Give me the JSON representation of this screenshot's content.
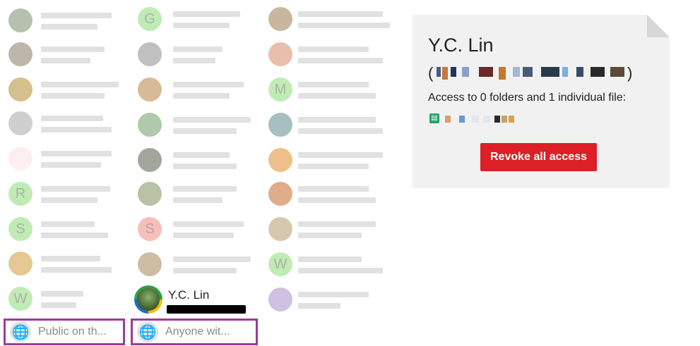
{
  "people": {
    "col1": [
      {
        "avatar": "photo",
        "color": "#7a8c6a"
      },
      {
        "avatar": "photo",
        "color": "#8a7a66"
      },
      {
        "avatar": "photo",
        "color": "#b28a2f"
      },
      {
        "avatar": "photo",
        "color": "#a7a7a7"
      },
      {
        "avatar": "logo",
        "color": "#e24a4a"
      },
      {
        "avatar": "letter",
        "letter": "R",
        "color": "#8fdc7a"
      },
      {
        "avatar": "letter",
        "letter": "S",
        "color": "#8fdc7a"
      },
      {
        "avatar": "photo",
        "color": "#d49a3a"
      },
      {
        "avatar": "letter",
        "letter": "W",
        "color": "#8fdc7a"
      }
    ],
    "col2": [
      {
        "avatar": "letter",
        "letter": "G",
        "color": "#8fdc7a"
      },
      {
        "avatar": "photo",
        "color": "#8d8d8d"
      },
      {
        "avatar": "photo",
        "color": "#b7823f"
      },
      {
        "avatar": "photo",
        "color": "#6d9d64"
      },
      {
        "avatar": "photo",
        "color": "#555c49"
      },
      {
        "avatar": "photo",
        "color": "#7f8f5a"
      },
      {
        "avatar": "letter",
        "letter": "S",
        "color": "#f28b82"
      },
      {
        "avatar": "photo",
        "color": "#a48857"
      }
    ],
    "col3": [
      {
        "avatar": "photo",
        "color": "#9b7c4e"
      },
      {
        "avatar": "photo",
        "color": "#d9896a"
      },
      {
        "avatar": "letter",
        "letter": "M",
        "color": "#8fdc7a"
      },
      {
        "avatar": "photo",
        "color": "#5d8a8e"
      },
      {
        "avatar": "photo",
        "color": "#e08a2a"
      },
      {
        "avatar": "photo",
        "color": "#c76a2a"
      },
      {
        "avatar": "photo",
        "color": "#b49a6e"
      },
      {
        "avatar": "letter",
        "letter": "W",
        "color": "#8fdc7a"
      },
      {
        "avatar": "photo",
        "color": "#a58ec9"
      }
    ]
  },
  "selected_user": {
    "name": "Y.C. Lin"
  },
  "public_options": [
    {
      "label": "Public on th...",
      "icon": "globe-icon"
    },
    {
      "label": "Anyone wit...",
      "icon": "globe-link-icon"
    }
  ],
  "detail_card": {
    "name": "Y.C. Lin",
    "paren_open": "(",
    "paren_close": ")",
    "access_summary": "Access to 0 folders and 1 individual file:",
    "file_icon": "google-sheets-icon",
    "revoke_label": "Revoke all access",
    "revoke_color": "#dd1f28"
  }
}
